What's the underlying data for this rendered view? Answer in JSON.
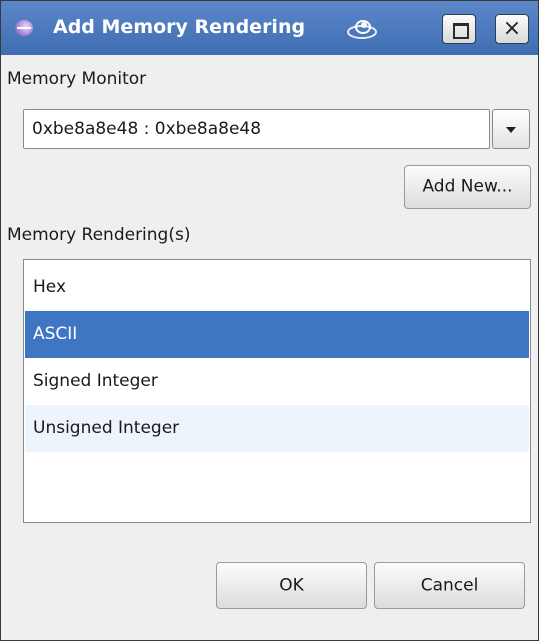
{
  "window": {
    "title": "Add Memory Rendering",
    "close_glyph": "×"
  },
  "monitor": {
    "label": "Memory Monitor",
    "selected_value": "0xbe8a8e48 : 0xbe8a8e48",
    "add_new_label": "Add New..."
  },
  "renderings": {
    "label": "Memory Rendering(s)",
    "items": [
      {
        "label": "Hex",
        "selected": false
      },
      {
        "label": "ASCII",
        "selected": true
      },
      {
        "label": "Signed Integer",
        "selected": false
      },
      {
        "label": "Unsigned Integer",
        "selected": false
      }
    ]
  },
  "buttons": {
    "ok_label": "OK",
    "cancel_label": "Cancel"
  },
  "colors": {
    "titlebar": "#4a7bc0",
    "selection": "#3f76c4"
  }
}
